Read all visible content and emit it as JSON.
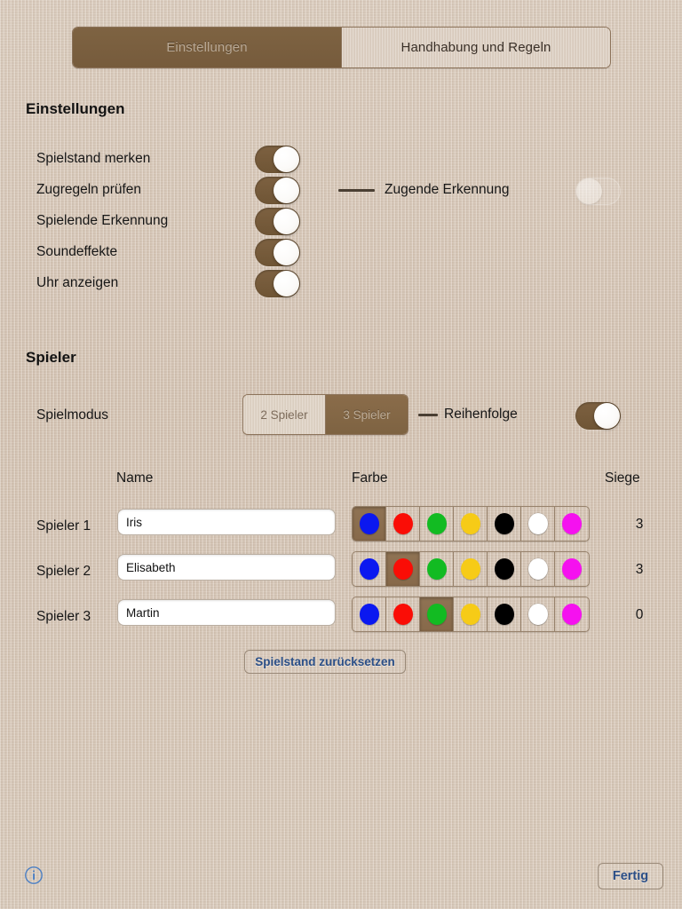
{
  "colors": {
    "background": "#d5c4b3",
    "accent_brown": "#7e6342",
    "switch_on": "#7d6141",
    "link_blue": "#2b4f87"
  },
  "tabs": [
    {
      "label": "Einstellungen",
      "active": true
    },
    {
      "label": "Handhabung und Regeln",
      "active": false
    }
  ],
  "settings": {
    "heading": "Einstellungen",
    "rows": [
      {
        "label": "Spielstand merken",
        "state": "on"
      },
      {
        "label": "Zugregeln prüfen",
        "state": "on"
      },
      {
        "label": "Spielende Erkennung",
        "state": "on"
      },
      {
        "label": "Soundeffekte",
        "state": "on"
      },
      {
        "label": "Uhr anzeigen",
        "state": "on"
      }
    ],
    "sub_option": {
      "label": "Zugende Erkennung",
      "state": "off"
    }
  },
  "players_section": {
    "heading": "Spieler",
    "mode_label": "Spielmodus",
    "mode_options": [
      {
        "label": "2 Spieler",
        "selected": false
      },
      {
        "label": "3 Spieler",
        "selected": true
      }
    ],
    "order_label": "Reihenfolge",
    "order_state": "on",
    "columns": {
      "player": "",
      "name": "Name",
      "color": "Farbe",
      "wins": "Siege"
    },
    "palette": [
      {
        "name": "blau",
        "hex": "#0b18f0"
      },
      {
        "name": "rot",
        "hex": "#fa0d06"
      },
      {
        "name": "gruen",
        "hex": "#12bb22"
      },
      {
        "name": "gelb",
        "hex": "#f6cb17"
      },
      {
        "name": "schwarz",
        "hex": "#000000"
      },
      {
        "name": "weiss",
        "hex": "#ffffff"
      },
      {
        "name": "magenta",
        "hex": "#f511ef"
      }
    ],
    "rows": [
      {
        "label": "Spieler 1",
        "name": "Iris",
        "color_index": 0,
        "wins": "3"
      },
      {
        "label": "Spieler 2",
        "name": "Elisabeth",
        "color_index": 1,
        "wins": "3"
      },
      {
        "label": "Spieler 3",
        "name": "Martin",
        "color_index": 2,
        "wins": "0"
      }
    ],
    "reset_button": "Spielstand zurücksetzen"
  },
  "footer": {
    "info_icon": "info-circle-icon",
    "done_button": "Fertig"
  }
}
